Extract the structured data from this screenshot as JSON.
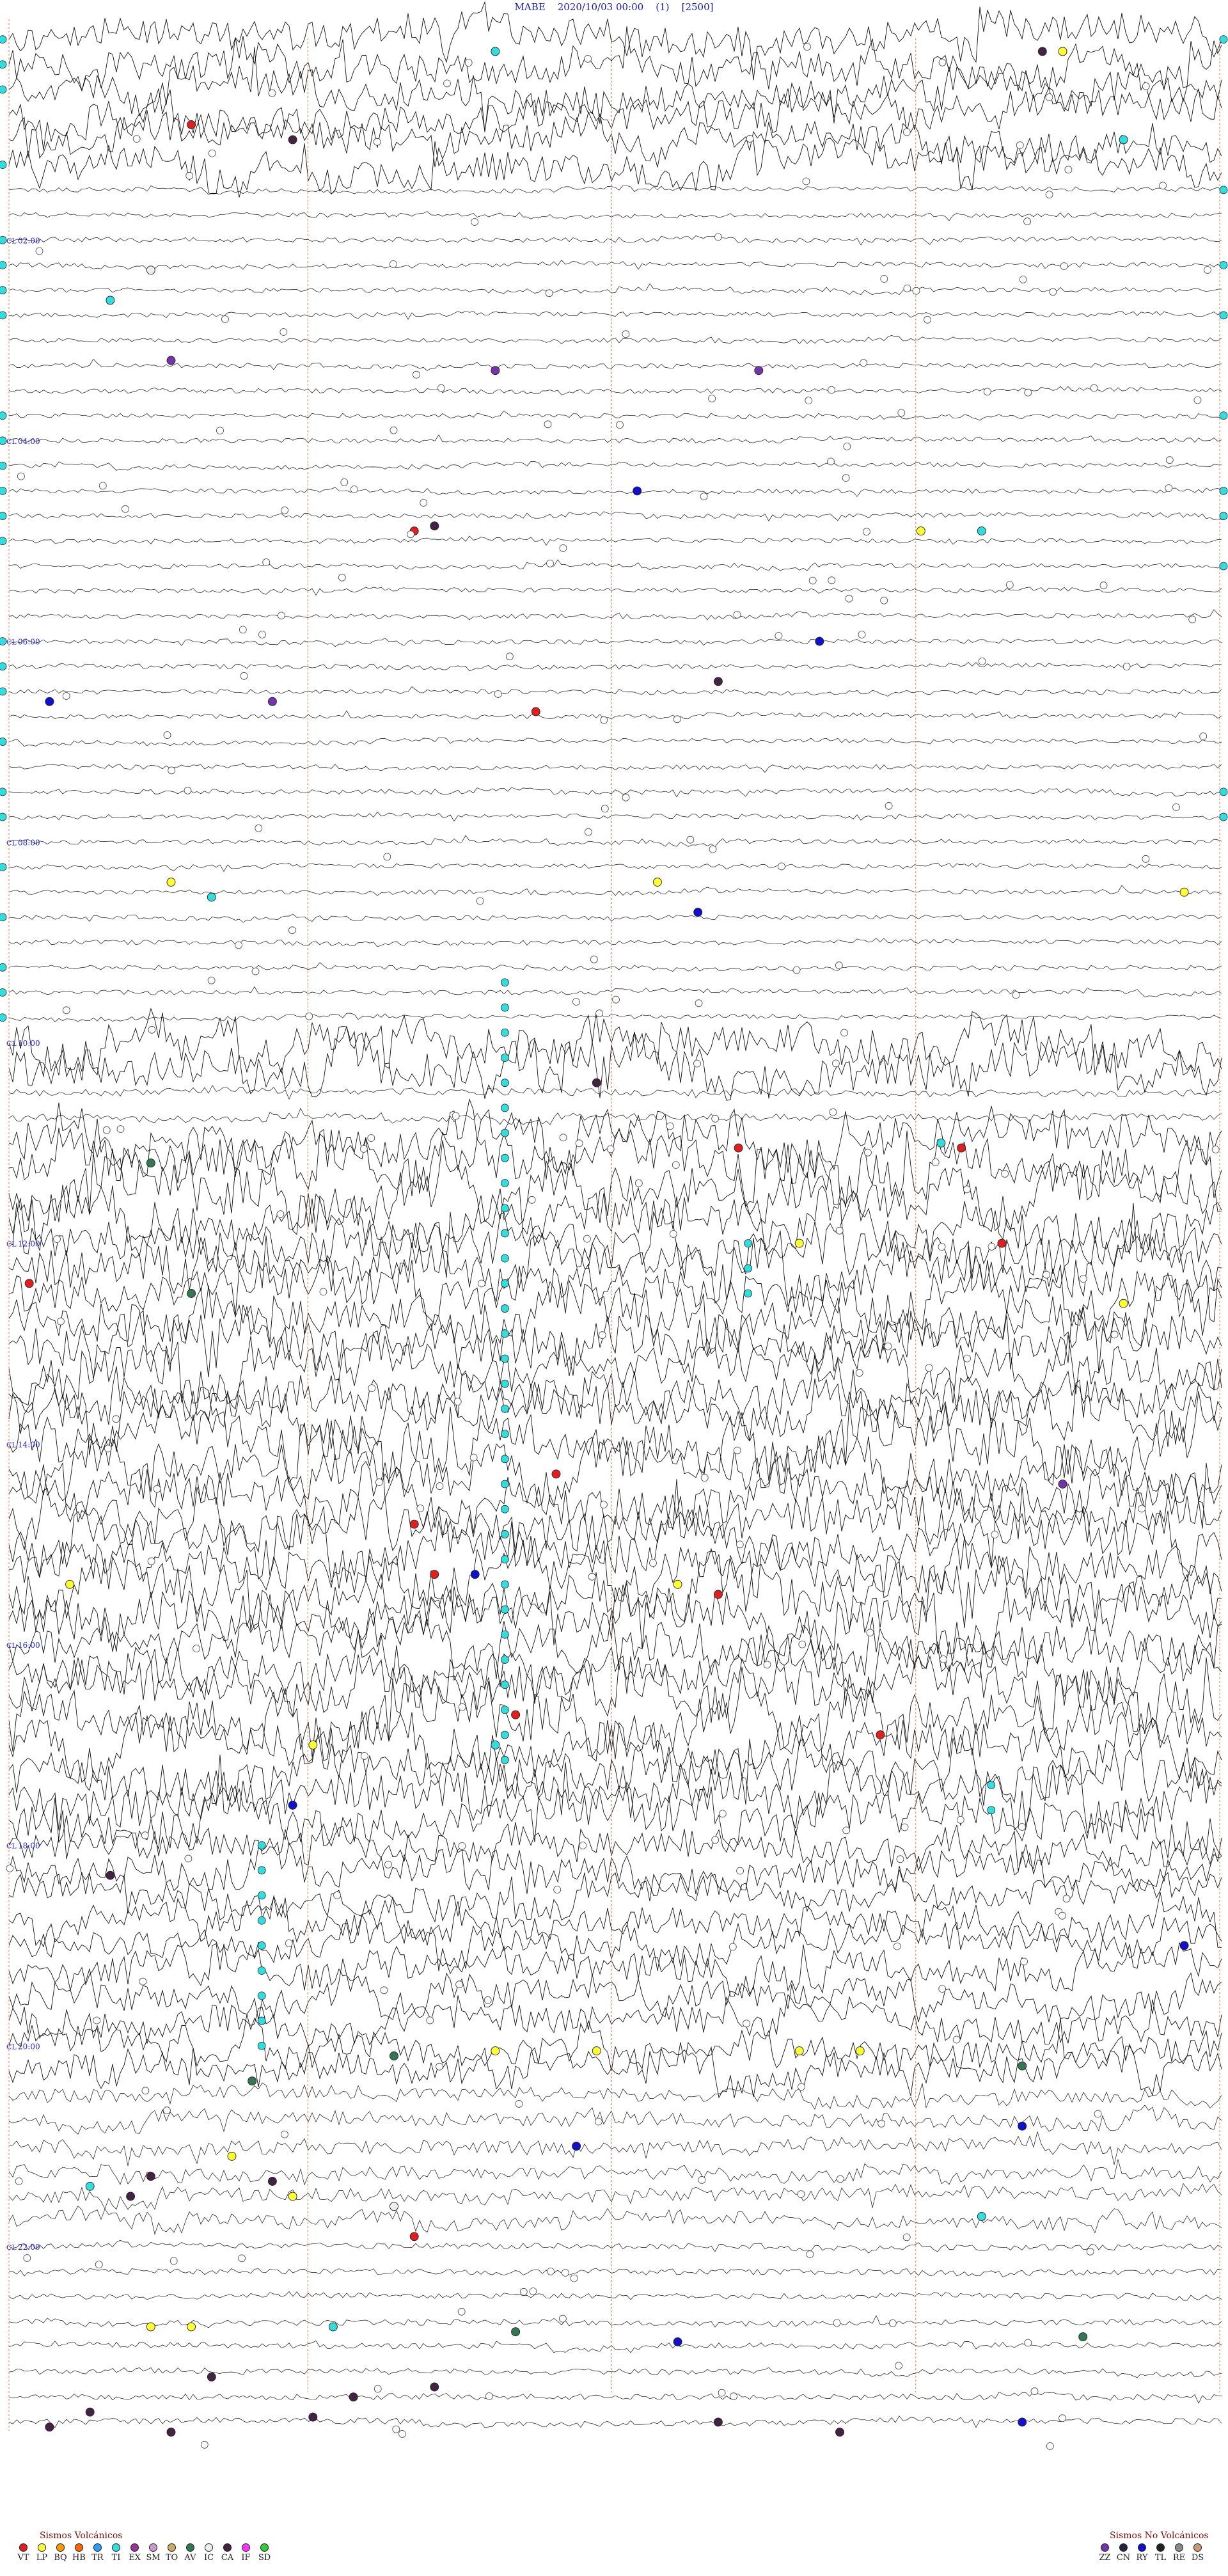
{
  "header": {
    "station": "MABE",
    "datetime": "2020/10/03 00:00",
    "channel": "(1)",
    "scale": "[2500]"
  },
  "chart_data": {
    "type": "helicorder",
    "station": "MABE",
    "start": "2020/10/03 00:00",
    "rows_per_hour": 4,
    "hours": 24,
    "time_labels": [
      "02:00",
      "04:00",
      "06:00",
      "08:00",
      "10:00",
      "12:00",
      "14:00",
      "16:00",
      "18:00",
      "20:00",
      "22:00"
    ],
    "noise_bands": [
      {
        "from_hour": 0.0,
        "to_hour": 1.5,
        "level": 0.75
      },
      {
        "from_hour": 1.5,
        "to_hour": 10.0,
        "level": 0.12
      },
      {
        "from_hour": 10.0,
        "to_hour": 10.5,
        "level": 0.9
      },
      {
        "from_hour": 10.5,
        "to_hour": 11.0,
        "level": 0.18
      },
      {
        "from_hour": 11.0,
        "to_hour": 18.0,
        "level": 1.0
      },
      {
        "from_hour": 18.0,
        "to_hour": 20.5,
        "level": 0.7
      },
      {
        "from_hour": 20.5,
        "to_hour": 22.0,
        "level": 0.35
      },
      {
        "from_hour": 22.0,
        "to_hour": 24.0,
        "level": 0.15
      }
    ],
    "events": [
      {
        "type": "LP",
        "hour": 0.12,
        "min": 52
      },
      {
        "type": "TI",
        "hour": 0.12,
        "min": 24
      },
      {
        "type": "CA",
        "hour": 0.12,
        "min": 51
      },
      {
        "type": "VT",
        "hour": 0.85,
        "min": 9
      },
      {
        "type": "CA",
        "hour": 1.0,
        "min": 14
      },
      {
        "type": "TI",
        "hour": 1.0,
        "min": 55
      },
      {
        "type": "IC",
        "hour": 2.3,
        "min": 7
      },
      {
        "type": "TI",
        "hour": 2.6,
        "min": 5
      },
      {
        "type": "ZZ",
        "hour": 3.2,
        "min": 8
      },
      {
        "type": "ZZ",
        "hour": 3.3,
        "min": 24
      },
      {
        "type": "ZZ",
        "hour": 3.3,
        "min": 37
      },
      {
        "type": "RY",
        "hour": 4.5,
        "min": 31
      },
      {
        "type": "VT",
        "hour": 4.9,
        "min": 20
      },
      {
        "type": "CA",
        "hour": 4.85,
        "min": 21
      },
      {
        "type": "LP",
        "hour": 4.9,
        "min": 45
      },
      {
        "type": "TI",
        "hour": 4.9,
        "min": 48
      },
      {
        "type": "RY",
        "hour": 6.0,
        "min": 40
      },
      {
        "type": "CA",
        "hour": 6.4,
        "min": 35
      },
      {
        "type": "RY",
        "hour": 6.6,
        "min": 2
      },
      {
        "type": "ZZ",
        "hour": 6.6,
        "min": 13
      },
      {
        "type": "VT",
        "hour": 6.7,
        "min": 26
      },
      {
        "type": "LP",
        "hour": 8.4,
        "min": 8
      },
      {
        "type": "LP",
        "hour": 8.4,
        "min": 32
      },
      {
        "type": "LP",
        "hour": 8.5,
        "min": 58
      },
      {
        "type": "TI",
        "hour": 8.55,
        "min": 10
      },
      {
        "type": "RY",
        "hour": 8.7,
        "min": 34
      },
      {
        "type": "CA",
        "hour": 10.4,
        "min": 29
      },
      {
        "type": "VT",
        "hour": 11.05,
        "min": 36
      },
      {
        "type": "VT",
        "hour": 11.05,
        "min": 47
      },
      {
        "type": "TI",
        "hour": 11.0,
        "min": 46
      },
      {
        "type": "AV",
        "hour": 11.2,
        "min": 7
      },
      {
        "type": "LP",
        "hour": 12.0,
        "min": 39
      },
      {
        "type": "VT",
        "hour": 12.0,
        "min": 49
      },
      {
        "type": "VT",
        "hour": 12.4,
        "min": 1
      },
      {
        "type": "AV",
        "hour": 12.5,
        "min": 9
      },
      {
        "type": "LP",
        "hour": 12.6,
        "min": 55
      },
      {
        "type": "VT",
        "hour": 14.3,
        "min": 27
      },
      {
        "type": "ZZ",
        "hour": 14.4,
        "min": 52
      },
      {
        "type": "VT",
        "hour": 14.8,
        "min": 20
      },
      {
        "type": "VT",
        "hour": 15.3,
        "min": 21
      },
      {
        "type": "RY",
        "hour": 15.3,
        "min": 23
      },
      {
        "type": "LP",
        "hour": 15.4,
        "min": 33
      },
      {
        "type": "VT",
        "hour": 15.5,
        "min": 35
      },
      {
        "type": "LP",
        "hour": 15.4,
        "min": 3
      },
      {
        "type": "VT",
        "hour": 16.7,
        "min": 25
      },
      {
        "type": "VT",
        "hour": 16.9,
        "min": 43
      },
      {
        "type": "LP",
        "hour": 17.0,
        "min": 15
      },
      {
        "type": "TI",
        "hour": 17.0,
        "min": 24
      },
      {
        "type": "RY",
        "hour": 17.6,
        "min": 14
      },
      {
        "type": "CA",
        "hour": 18.3,
        "min": 5
      },
      {
        "type": "RY",
        "hour": 19.0,
        "min": 58
      },
      {
        "type": "LP",
        "hour": 20.05,
        "min": 24
      },
      {
        "type": "LP",
        "hour": 20.05,
        "min": 29
      },
      {
        "type": "LP",
        "hour": 20.05,
        "min": 39
      },
      {
        "type": "LP",
        "hour": 20.05,
        "min": 42
      },
      {
        "type": "AV",
        "hour": 20.1,
        "min": 19
      },
      {
        "type": "AV",
        "hour": 20.35,
        "min": 12
      },
      {
        "type": "AV",
        "hour": 20.2,
        "min": 50
      },
      {
        "type": "RY",
        "hour": 20.8,
        "min": 50
      },
      {
        "type": "RY",
        "hour": 21.0,
        "min": 28
      },
      {
        "type": "LP",
        "hour": 21.1,
        "min": 11
      },
      {
        "type": "CA",
        "hour": 21.3,
        "min": 7
      },
      {
        "type": "CA",
        "hour": 21.35,
        "min": 13
      },
      {
        "type": "TI",
        "hour": 21.4,
        "min": 4
      },
      {
        "type": "LP",
        "hour": 21.5,
        "min": 14
      },
      {
        "type": "CA",
        "hour": 21.5,
        "min": 6
      },
      {
        "type": "IC",
        "hour": 21.6,
        "min": 19
      },
      {
        "type": "VT",
        "hour": 21.9,
        "min": 20
      },
      {
        "type": "TI",
        "hour": 21.7,
        "min": 48
      },
      {
        "type": "LP",
        "hour": 22.8,
        "min": 7
      },
      {
        "type": "LP",
        "hour": 22.8,
        "min": 9
      },
      {
        "type": "TI",
        "hour": 22.8,
        "min": 16
      },
      {
        "type": "AV",
        "hour": 22.85,
        "min": 25
      },
      {
        "type": "RY",
        "hour": 22.95,
        "min": 33
      },
      {
        "type": "AV",
        "hour": 22.9,
        "min": 53
      },
      {
        "type": "CA",
        "hour": 23.3,
        "min": 10
      },
      {
        "type": "CA",
        "hour": 23.4,
        "min": 21
      },
      {
        "type": "CA",
        "hour": 23.5,
        "min": 17
      },
      {
        "type": "CA",
        "hour": 23.65,
        "min": 4
      },
      {
        "type": "CA",
        "hour": 23.7,
        "min": 15
      },
      {
        "type": "CA",
        "hour": 23.75,
        "min": 35
      },
      {
        "type": "RY",
        "hour": 23.75,
        "min": 50
      },
      {
        "type": "CA",
        "hour": 23.8,
        "min": 2
      },
      {
        "type": "CA",
        "hour": 23.85,
        "min": 8
      },
      {
        "type": "CA",
        "hour": 23.85,
        "min": 41
      }
    ],
    "tremor_columns": [
      {
        "min": 36,
        "from_hour": 9.4,
        "to_hour": 17.3
      },
      {
        "min": 48,
        "from_hour": 18.0,
        "to_hour": 20.0
      },
      {
        "min": 24,
        "from_hour": 12.0,
        "to_hour": 12.6
      },
      {
        "min": 12,
        "from_hour": 17.4,
        "to_hour": 17.8
      }
    ]
  },
  "legend": {
    "volcanic_title": "Sismos Volcánicos",
    "volcanic": [
      {
        "code": "VT",
        "color": "#e02020"
      },
      {
        "code": "LP",
        "color": "#ffff33"
      },
      {
        "code": "BQ",
        "color": "#ff9900"
      },
      {
        "code": "HB",
        "color": "#ff6600"
      },
      {
        "code": "TR",
        "color": "#3399ff"
      },
      {
        "code": "TI",
        "color": "#33dddd"
      },
      {
        "code": "EX",
        "color": "#993399"
      },
      {
        "code": "SM",
        "color": "#cc99cc"
      },
      {
        "code": "TO",
        "color": "#ccaa66"
      },
      {
        "code": "AV",
        "color": "#337755"
      },
      {
        "code": "IC",
        "color": "#eeeeee"
      },
      {
        "code": "CA",
        "color": "#442244"
      },
      {
        "code": "IF",
        "color": "#ff33ff"
      },
      {
        "code": "SD",
        "color": "#33cc33"
      }
    ],
    "nonvolcanic_title": "Sismos No Volcánicos",
    "nonvolcanic": [
      {
        "code": "ZZ",
        "color": "#7733aa"
      },
      {
        "code": "CN",
        "color": "#222244"
      },
      {
        "code": "RY",
        "color": "#1111cc"
      },
      {
        "code": "TL",
        "color": "#222222"
      },
      {
        "code": "RE",
        "color": "#888888"
      },
      {
        "code": "DS",
        "color": "#cc9977"
      }
    ]
  }
}
